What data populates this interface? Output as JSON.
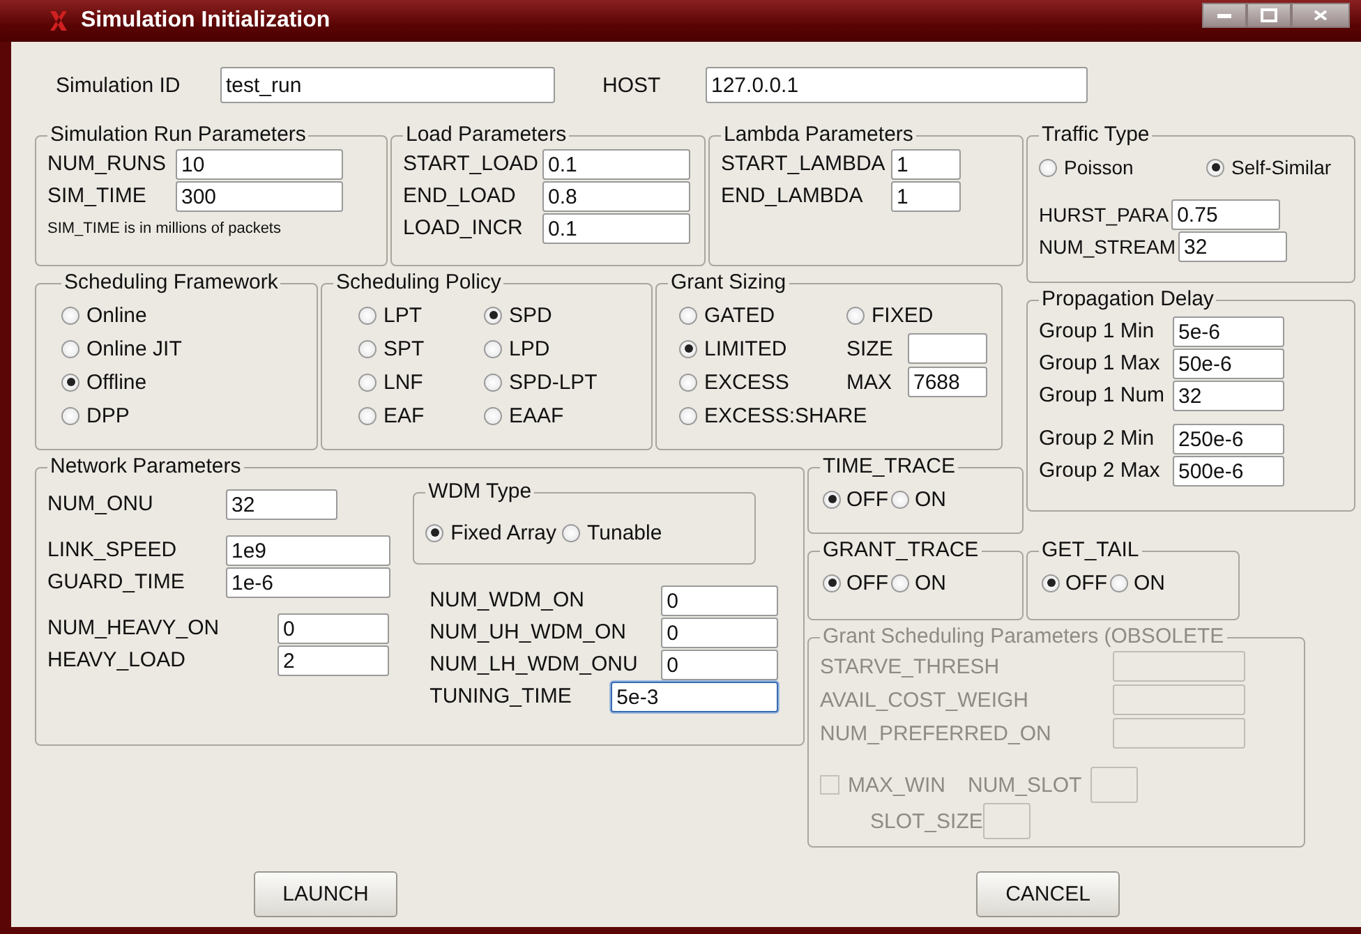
{
  "window": {
    "title": "Simulation Initialization"
  },
  "header": [
    {
      "label": "Simulation ID",
      "value": "test_run"
    },
    {
      "label": "HOST",
      "value": "127.0.0.1"
    }
  ],
  "simulation_run": {
    "title": "Simulation Run Parameters",
    "fields": [
      {
        "label": "NUM_RUNS",
        "value": "10"
      },
      {
        "label": "SIM_TIME",
        "value": "300"
      }
    ],
    "note": "SIM_TIME is in millions of packets"
  },
  "load": {
    "title": "Load Parameters",
    "fields": [
      {
        "label": "START_LOAD",
        "value": "0.1"
      },
      {
        "label": "END_LOAD",
        "value": "0.8"
      },
      {
        "label": "LOAD_INCR",
        "value": "0.1"
      }
    ]
  },
  "lambda": {
    "title": "Lambda Parameters",
    "fields": [
      {
        "label": "START_LAMBDA",
        "value": "1"
      },
      {
        "label": "END_LAMBDA",
        "value": "1"
      }
    ]
  },
  "traffic_type": {
    "title": "Traffic Type",
    "options": [
      {
        "label": "Poisson",
        "selected": false
      },
      {
        "label": "Self-Similar",
        "selected": true
      }
    ],
    "fields": [
      {
        "label": "HURST_PARA",
        "value": "0.75"
      },
      {
        "label": "NUM_STREAM",
        "value": "32"
      }
    ]
  },
  "scheduling_framework": {
    "title": "Scheduling Framework",
    "options": [
      {
        "label": "Online",
        "selected": false
      },
      {
        "label": "Online JIT",
        "selected": false
      },
      {
        "label": "Offline",
        "selected": true
      },
      {
        "label": "DPP",
        "selected": false
      }
    ]
  },
  "scheduling_policy": {
    "title": "Scheduling Policy",
    "options": [
      {
        "label": "LPT",
        "selected": false
      },
      {
        "label": "SPD",
        "selected": true
      },
      {
        "label": "SPT",
        "selected": false
      },
      {
        "label": "LPD",
        "selected": false
      },
      {
        "label": "LNF",
        "selected": false
      },
      {
        "label": "SPD-LPT",
        "selected": false
      },
      {
        "label": "EAF",
        "selected": false
      },
      {
        "label": "EAAF",
        "selected": false
      }
    ]
  },
  "grant_sizing": {
    "title": "Grant Sizing",
    "items": [
      {
        "kind": "radio",
        "label": "GATED",
        "selected": false
      },
      {
        "kind": "radio",
        "label": "FIXED",
        "selected": false
      },
      {
        "kind": "radio",
        "label": "LIMITED",
        "selected": true
      },
      {
        "kind": "field",
        "label": "SIZE"
      },
      {
        "kind": "radio",
        "label": "EXCESS",
        "selected": false
      },
      {
        "kind": "field",
        "label": "MAX",
        "value": "7688"
      },
      {
        "kind": "radio",
        "label": "EXCESS:SHARE",
        "selected": false
      }
    ]
  },
  "propagation_delay": {
    "title": "Propagation Delay",
    "groups": [
      [
        {
          "label": "Group 1 Min",
          "value": "5e-6"
        },
        {
          "label": "Group 1 Max",
          "value": "50e-6"
        },
        {
          "label": "Group 1 Num",
          "value": "32"
        }
      ],
      [
        {
          "label": "Group 2 Min",
          "value": "250e-6"
        },
        {
          "label": "Group 2 Max",
          "value": "500e-6"
        }
      ]
    ]
  },
  "network": {
    "title": "Network Parameters",
    "groups": [
      [
        {
          "label": "NUM_ONU",
          "value": "32"
        }
      ],
      [
        {
          "label": "LINK_SPEED",
          "value": "1e9"
        },
        {
          "label": "GUARD_TIME",
          "value": "1e-6"
        }
      ],
      [
        {
          "label": "NUM_HEAVY_ON",
          "value": "0"
        },
        {
          "label": "HEAVY_LOAD",
          "value": "2"
        }
      ]
    ],
    "wdm_type": {
      "title": "WDM Type",
      "options": [
        {
          "label": "Fixed Array",
          "selected": true
        },
        {
          "label": "Tunable",
          "selected": false
        }
      ]
    },
    "wdm_fields": [
      {
        "label": "NUM_WDM_ON",
        "value": "0",
        "focused": false
      },
      {
        "label": "NUM_UH_WDM_ON",
        "value": "0",
        "focused": false
      },
      {
        "label": "NUM_LH_WDM_ONU",
        "value": "0",
        "focused": false
      },
      {
        "label": "TUNING_TIME",
        "value": "5e-3",
        "focused": true
      }
    ]
  },
  "time_trace": {
    "title": "TIME_TRACE",
    "options": [
      {
        "label": "OFF",
        "selected": true
      },
      {
        "label": "ON",
        "selected": false
      }
    ]
  },
  "grant_trace": {
    "title": "GRANT_TRACE",
    "options": [
      {
        "label": "OFF",
        "selected": true
      },
      {
        "label": "ON",
        "selected": false
      }
    ]
  },
  "get_tail": {
    "title": "GET_TAIL",
    "options": [
      {
        "label": "OFF",
        "selected": true
      },
      {
        "label": "ON",
        "selected": false
      }
    ]
  },
  "grant_scheduling": {
    "title": "Grant Scheduling Parameters (OBSOLETE",
    "disabled": true,
    "fields": [
      {
        "label": "STARVE_THRESH"
      },
      {
        "label": "AVAIL_COST_WEIGH"
      },
      {
        "label": "NUM_PREFERRED_ON"
      }
    ],
    "checkbox": {
      "label": "MAX_WIN",
      "checked": false
    },
    "small_fields": [
      {
        "label": "NUM_SLOT"
      },
      {
        "label": "SLOT_SIZE"
      }
    ]
  },
  "buttons": [
    "LAUNCH",
    "CANCEL"
  ]
}
